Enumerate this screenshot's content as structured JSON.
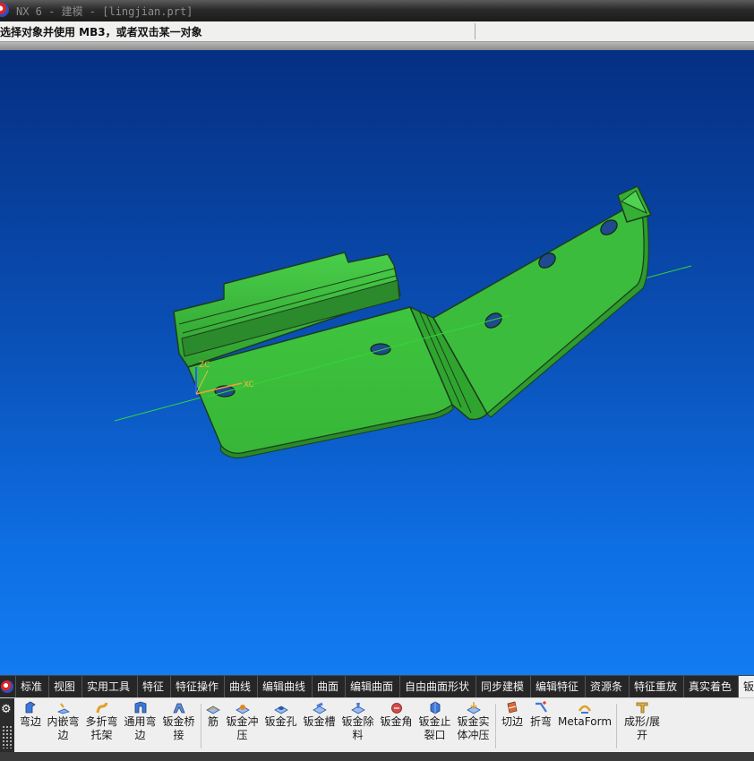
{
  "window": {
    "title": "NX 6 - 建模 - [lingjian.prt]"
  },
  "cue_line": {
    "text": "选择对象并使用 MB3，或者双击某一对象"
  },
  "colors": {
    "part_green": "#3cbc3c",
    "viewport_top": "#052f82",
    "viewport_bottom": "#137cf2"
  },
  "tabs": [
    {
      "label": "标准"
    },
    {
      "label": "视图"
    },
    {
      "label": "实用工具"
    },
    {
      "label": "特征"
    },
    {
      "label": "特征操作"
    },
    {
      "label": "曲线"
    },
    {
      "label": "编辑曲线"
    },
    {
      "label": "曲面"
    },
    {
      "label": "编辑曲面"
    },
    {
      "label": "自由曲面形状"
    },
    {
      "label": "同步建模"
    },
    {
      "label": "编辑特征"
    },
    {
      "label": "资源条"
    },
    {
      "label": "特征重放"
    },
    {
      "label": "真实着色"
    },
    {
      "label": "钣金",
      "active": true
    }
  ],
  "ribbon": {
    "buttons": [
      {
        "label": "弯边",
        "icon": "flange-icon"
      },
      {
        "label": "内嵌弯边",
        "icon": "inset-flange-icon"
      },
      {
        "label": "多折弯托架",
        "icon": "multi-bend-bracket-icon"
      },
      {
        "label": "通用弯边",
        "icon": "general-flange-icon"
      },
      {
        "label": "钣金桥接",
        "icon": "bridge-icon"
      },
      {
        "label": "筋",
        "icon": "bead-icon"
      },
      {
        "label": "钣金冲压",
        "icon": "punch-icon"
      },
      {
        "label": "钣金孔",
        "icon": "hole-icon"
      },
      {
        "label": "钣金槽",
        "icon": "slot-icon"
      },
      {
        "label": "钣金除料",
        "icon": "cutout-icon"
      },
      {
        "label": "钣金角",
        "icon": "corner-icon"
      },
      {
        "label": "钣金止裂口",
        "icon": "relief-icon"
      },
      {
        "label": "钣金实体冲压",
        "icon": "solid-punch-icon"
      },
      {
        "label": "切边",
        "icon": "trim-edge-icon"
      },
      {
        "label": "折弯",
        "icon": "bend-icon"
      },
      {
        "label": "MetaForm",
        "icon": "metaform-icon"
      },
      {
        "label": "成形/展开",
        "icon": "form-unform-icon"
      }
    ]
  },
  "viewport": {
    "axis_labels": {
      "z": "ZC",
      "x": "XC"
    }
  }
}
